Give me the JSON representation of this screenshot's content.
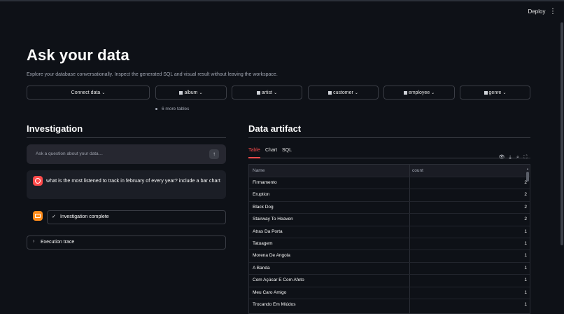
{
  "header": {
    "deploy_label": "Deploy",
    "menu_glyph": "⋮"
  },
  "page": {
    "title": "Ask your data",
    "subtitle": "Explore your database conversationally. Inspect the generated SQL and visual result without leaving the workspace."
  },
  "tables": {
    "connect_label": "Connect data",
    "items": [
      "album",
      "artist",
      "customer",
      "employee",
      "genre"
    ],
    "more_label": "6 more tables"
  },
  "investigation": {
    "heading": "Investigation",
    "input_placeholder": "Ask a question about your data…",
    "send_glyph": "↑",
    "user_message": "what is the most listened to track in february of every year? include a bar chart",
    "status_label": "Investigation complete",
    "trace_label": "Execution trace"
  },
  "artifact": {
    "heading": "Data artifact",
    "tabs": [
      "Table",
      "Chart",
      "SQL"
    ],
    "active_tab": "Table",
    "toolbar_icons": [
      "eye-icon",
      "download-icon",
      "search-icon",
      "fullscreen-icon"
    ],
    "columns": [
      "Name",
      "count"
    ],
    "rows": [
      {
        "name": "Firmamento",
        "count": "2"
      },
      {
        "name": "Eruption",
        "count": "2"
      },
      {
        "name": "Black Dog",
        "count": "2"
      },
      {
        "name": "Stairway To Heaven",
        "count": "2"
      },
      {
        "name": "Atras Da Porta",
        "count": "1"
      },
      {
        "name": "Tatuagem",
        "count": "1"
      },
      {
        "name": "Morena De Angola",
        "count": "1"
      },
      {
        "name": "A Banda",
        "count": "1"
      },
      {
        "name": "Com Açúcar E Com Afeto",
        "count": "1"
      },
      {
        "name": "Meu Caro Amigo",
        "count": "1"
      },
      {
        "name": "Trocando Em Miúdos",
        "count": "1"
      }
    ]
  },
  "colors": {
    "accent": "#ff4b4b",
    "background": "#0e1117",
    "assistant_avatar": "#ff8c1a"
  }
}
